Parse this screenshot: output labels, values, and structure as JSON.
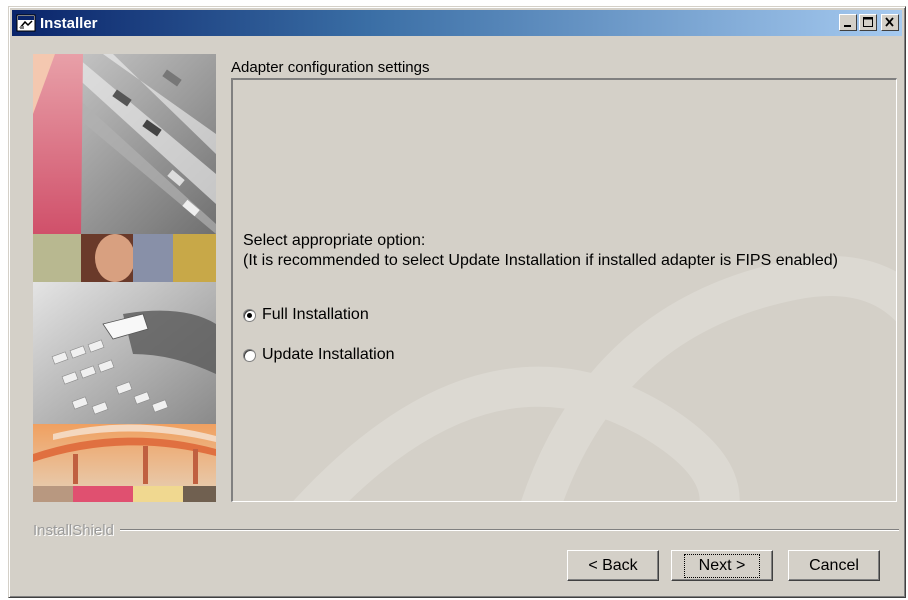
{
  "window": {
    "title": "Installer"
  },
  "panel": {
    "heading": "Adapter configuration settings",
    "prompt": "Select appropriate option:",
    "note": "(It is recommended to select Update Installation if installed adapter is FIPS enabled)",
    "options": [
      {
        "label": "Full Installation",
        "selected": true
      },
      {
        "label": "Update Installation",
        "selected": false
      }
    ]
  },
  "footer": {
    "brand": "InstallShield",
    "back_label": "< Back",
    "next_label": "Next >",
    "cancel_label": "Cancel"
  },
  "icons": {
    "app": "installer-icon",
    "minimize": "minimize-icon",
    "maximize": "maximize-icon",
    "close": "close-icon"
  },
  "colors": {
    "titlebar_start": "#0a246a",
    "titlebar_end": "#a6caf0",
    "window_bg": "#d4d0c8"
  }
}
